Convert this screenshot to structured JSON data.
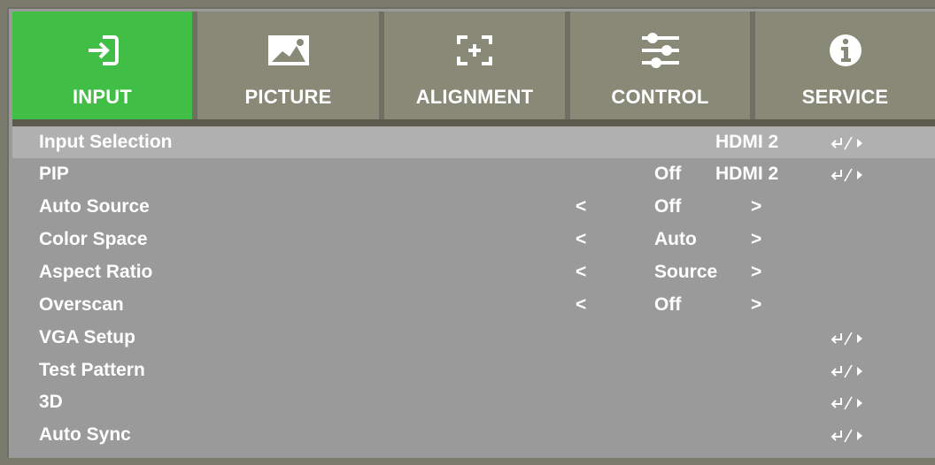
{
  "tabs": [
    {
      "label": "INPUT",
      "icon": "input-icon",
      "active": true
    },
    {
      "label": "PICTURE",
      "icon": "picture-icon",
      "active": false
    },
    {
      "label": "ALIGNMENT",
      "icon": "alignment-icon",
      "active": false
    },
    {
      "label": "CONTROL",
      "icon": "control-sliders-icon",
      "active": false
    },
    {
      "label": "SERVICE",
      "icon": "info-icon",
      "active": false
    }
  ],
  "colors": {
    "active_tab": "#41be45",
    "tab": "#898978",
    "menu_bg": "#9a9a9a",
    "selected_row": "#b0b0b0",
    "text": "#ffffff"
  },
  "menu": {
    "items": [
      {
        "label": "Input Selection",
        "value": "HDMI 2",
        "submenu": true
      },
      {
        "label": "PIP",
        "value": "Off",
        "value2": "HDMI 2",
        "submenu": true
      },
      {
        "label": "Auto Source",
        "left": "<",
        "value": "Off",
        "right": ">"
      },
      {
        "label": "Color Space",
        "left": "<",
        "value": "Auto",
        "right": ">"
      },
      {
        "label": "Aspect Ratio",
        "left": "<",
        "value": "Source",
        "right": ">"
      },
      {
        "label": "Overscan",
        "left": "<",
        "value": "Off",
        "right": ">"
      },
      {
        "label": "VGA Setup",
        "submenu": true
      },
      {
        "label": "Test Pattern",
        "submenu": true
      },
      {
        "label": "3D",
        "submenu": true
      },
      {
        "label": "Auto Sync",
        "submenu": true
      }
    ]
  }
}
